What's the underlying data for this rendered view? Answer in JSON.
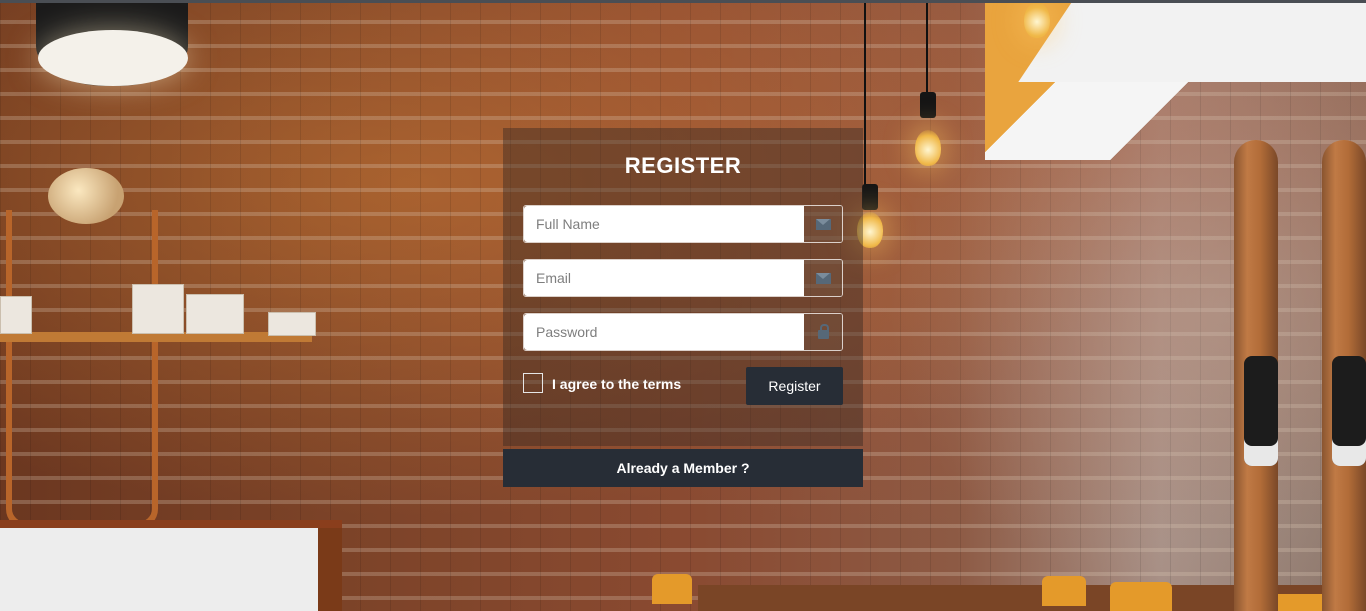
{
  "form": {
    "title": "REGISTER",
    "full_name": {
      "placeholder": "Full Name",
      "value": "",
      "icon": "envelope-icon"
    },
    "email": {
      "placeholder": "Email",
      "value": "",
      "icon": "envelope-icon"
    },
    "password": {
      "placeholder": "Password",
      "value": "",
      "icon": "lock-icon"
    },
    "agree_label": "I agree to the terms",
    "agree_checked": false,
    "register_label": "Register",
    "member_label": "Already a Member ?"
  },
  "theme": {
    "button_color": "#272d36",
    "panel_overlay": "rgba(50,38,34,0.42)"
  }
}
